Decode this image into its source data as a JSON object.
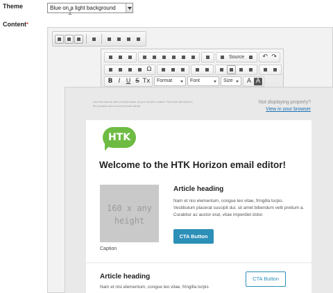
{
  "form": {
    "theme_label": "Theme",
    "theme_value": "Blue on a light background",
    "content_label": "Content",
    "required_mark": "*"
  },
  "editor": {
    "toolbar1": [
      "image-icon",
      "text-block-icon",
      "text-image-icon",
      "maximize-icon",
      "desktop-icon",
      "tablet-icon",
      "mobile-landscape-icon",
      "mobile-icon"
    ],
    "ck_row1": [
      "show-blocks-icon",
      "templates-icon",
      "save-icon",
      "cut-icon",
      "copy-icon",
      "paste-icon",
      "paste-text-icon",
      "paste-word-icon",
      "social-icons-icon",
      "spellcheck-icon",
      "source-icon",
      "preview-icon",
      "undo-icon",
      "redo-icon"
    ],
    "source_label": "Source",
    "ck_row2": [
      "image-icon",
      "table-icon",
      "horizontal-line-icon",
      "table-alt-icon",
      "special-char-icon",
      "link-icon",
      "unlink-icon",
      "anchor-icon",
      "numbered-list-icon",
      "bulleted-list-icon",
      "align-left-icon",
      "align-center-icon",
      "align-right-icon",
      "justify-icon",
      "outdent-icon",
      "indent-icon"
    ],
    "bold": "B",
    "italic": "I",
    "underline": "U",
    "strike": "S",
    "remove_format": "Tx",
    "format_label": "Format",
    "font_label": "Font",
    "size_label": "Size",
    "text_color_label": "A",
    "bg_color_label": "A"
  },
  "preview": {
    "preheader": "Use this area to offer a short teaser of your email's content. Text here will show in the preview area of some email clients.",
    "not_displaying": "Not displaying properly?",
    "view_in_browser": "View in your browser",
    "logo_text": "HTK",
    "welcome": "Welcome to the HTK Horizon email editor!",
    "placeholder_line1": "160 x any",
    "placeholder_line2": "height",
    "caption": "Caption",
    "article_heading": "Article heading",
    "article_body": "Nam et nisi elementum, congue leo vitae, fringilla turpis. Vestibulum placerat suscipit dui, sit amet bibendum velit pretium a. Curabitur ac auctor erat, vitae imperdiet dolor.",
    "cta_label": "CTA Button",
    "article_heading_2": "Article heading",
    "article_body_2": "Nam et nisi elementum, congue leo vitae, fringilla turpis",
    "cta_label_2": "CTA Button"
  },
  "colors": {
    "accent": "#2c8fb8",
    "logo_green": "#6dbb43"
  }
}
